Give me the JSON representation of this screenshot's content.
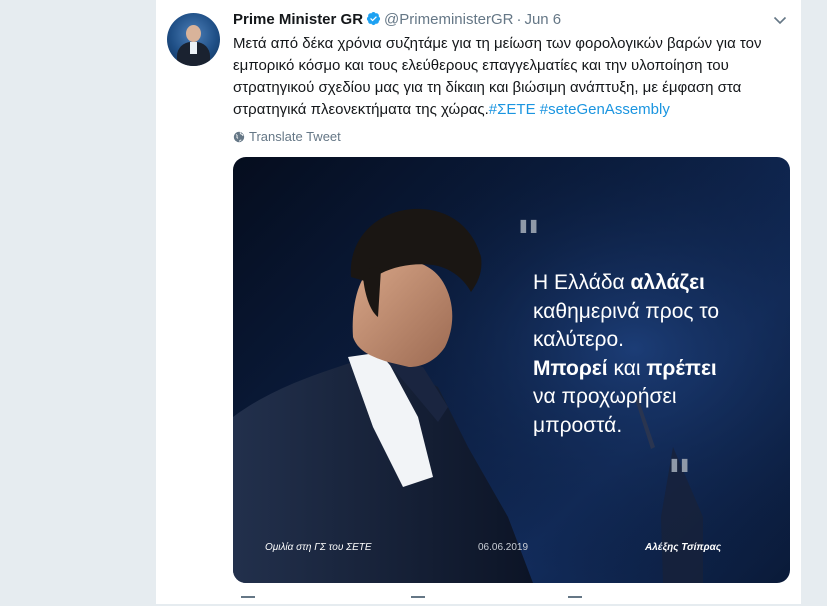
{
  "tweet": {
    "author_name": "Prime Minister GR",
    "handle": "@PrimeministerGR",
    "separator": "·",
    "date": "Jun 6",
    "text_main": "Μετά από δέκα χρόνια συζητάμε για τη μείωση των φορολογικών βαρών για τον εμπορικό κόσμο και τους ελεύθερους επαγγελματίες και την υλοποίηση του στρατηγικού σχεδίου μας για τη δίκαιη και βιώσιμη ανάπτυξη, με έμφαση στα στρατηγικά πλεονεκτήματα της χώρας.",
    "hashtags": [
      "#ΣΕΤΕ",
      "#seteGenAssembly"
    ],
    "translate_label": "Translate Tweet"
  },
  "media": {
    "quote_lines": [
      {
        "parts": [
          {
            "text": "Η Ελλάδα ",
            "bold": false
          },
          {
            "text": "αλλάζει",
            "bold": true
          }
        ]
      },
      {
        "parts": [
          {
            "text": "καθημερινά προς το",
            "bold": false
          }
        ]
      },
      {
        "parts": [
          {
            "text": "καλύτερο.",
            "bold": false
          }
        ]
      },
      {
        "parts": [
          {
            "text": "Μπορεί",
            "bold": true
          },
          {
            "text": " και ",
            "bold": false
          },
          {
            "text": "πρέπει",
            "bold": true
          }
        ]
      },
      {
        "parts": [
          {
            "text": "να προχωρήσει",
            "bold": false
          }
        ]
      },
      {
        "parts": [
          {
            "text": "μπροστά.",
            "bold": false
          }
        ]
      }
    ],
    "caption_event": "Ομιλία στη ΓΣ του ΣΕΤΕ",
    "caption_date": "06.06.2019",
    "caption_author": "Αλέξης Τσίπρας"
  },
  "icons": {
    "verified": "verified-badge-icon",
    "caret": "chevron-down-icon",
    "translate": "globe-icon"
  },
  "colors": {
    "link": "#1b95e0",
    "secondary_text": "#657786",
    "verified": "#1da1f2",
    "page_background": "#e6ecf0"
  }
}
